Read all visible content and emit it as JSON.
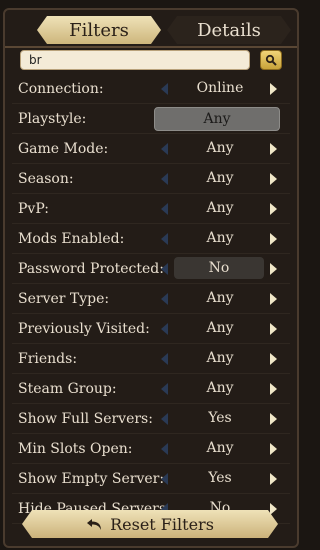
{
  "tabs": {
    "filters": "Filters",
    "details": "Details"
  },
  "search": {
    "value": "br",
    "icon": "search-icon"
  },
  "rows": [
    {
      "label": "Connection:",
      "value": "Online"
    },
    {
      "label": "Playstyle:",
      "value": "Any"
    },
    {
      "label": "Game Mode:",
      "value": "Any"
    },
    {
      "label": "Season:",
      "value": "Any"
    },
    {
      "label": "PvP:",
      "value": "Any"
    },
    {
      "label": "Mods Enabled:",
      "value": "Any"
    },
    {
      "label": "Password Protected:",
      "value": "No"
    },
    {
      "label": "Server Type:",
      "value": "Any"
    },
    {
      "label": "Previously Visited:",
      "value": "Any"
    },
    {
      "label": "Friends:",
      "value": "Any"
    },
    {
      "label": "Steam Group:",
      "value": "Any"
    },
    {
      "label": "Show Full Servers:",
      "value": "Yes"
    },
    {
      "label": "Min Slots Open:",
      "value": "Any"
    },
    {
      "label": "Show Empty Server:",
      "value": "Yes"
    },
    {
      "label": "Hide Paused Servers",
      "value": "No"
    }
  ],
  "reset": {
    "label": "Reset Filters",
    "icon": "undo-icon"
  }
}
